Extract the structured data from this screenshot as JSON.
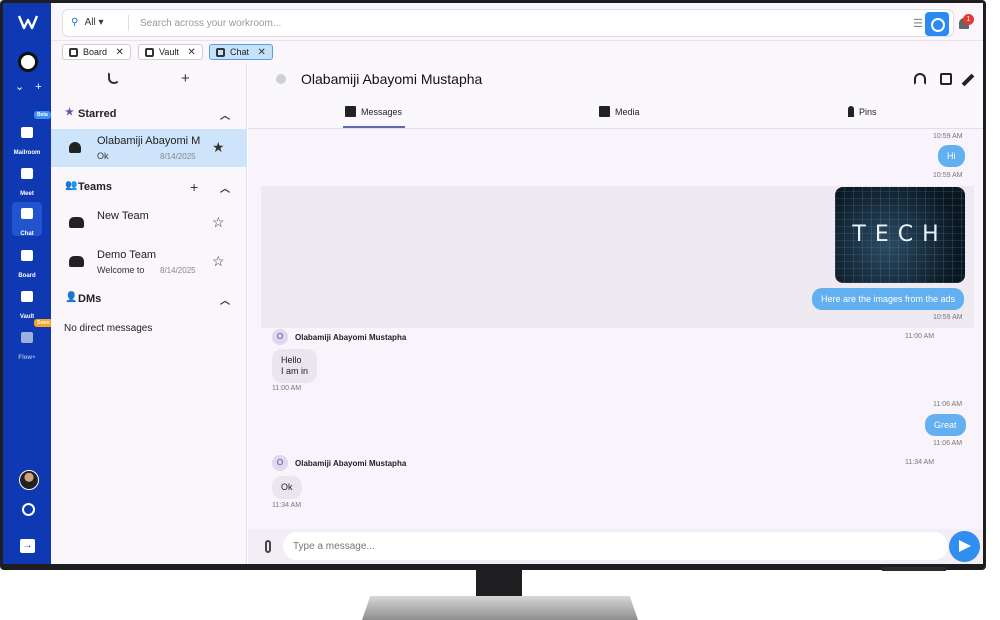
{
  "rail": {
    "items": [
      {
        "label": "Mailroom",
        "icon": "mailroom-icon"
      },
      {
        "label": "Meet",
        "icon": "video-icon"
      },
      {
        "label": "Chat",
        "icon": "chat-icon"
      },
      {
        "label": "Board",
        "icon": "board-icon"
      },
      {
        "label": "Vault",
        "icon": "vault-icon"
      },
      {
        "label": "Flow+",
        "icon": "flow-icon"
      }
    ],
    "badge_beta": "Beta",
    "badge_soon": "Soon",
    "ws_caret": "⌄",
    "ws_add": "+"
  },
  "search": {
    "scope": "All",
    "placeholder": "Search across your workroom..."
  },
  "notifications": {
    "count": "1"
  },
  "app_tabs": [
    {
      "label": "Board"
    },
    {
      "label": "Vault"
    },
    {
      "label": "Chat"
    }
  ],
  "sidebar": {
    "starred": {
      "title": "Starred",
      "items": [
        {
          "name": "Olabamiji Abayomi Mustapha",
          "preview": "Ok",
          "date": "8/14/2025"
        }
      ]
    },
    "teams": {
      "title": "Teams",
      "items": [
        {
          "name": "New Team",
          "preview": "",
          "date": ""
        },
        {
          "name": "Demo Team",
          "preview": "Welcome to Demo Team",
          "date": "8/14/2025"
        }
      ]
    },
    "dms": {
      "title": "DMs",
      "empty": "No direct messages"
    }
  },
  "chat": {
    "title": "Olabamiji Abayomi Mustapha",
    "tabs": [
      "Messages",
      "Media",
      "Pins"
    ],
    "messages": [
      {
        "ts_top": "10:59 AM",
        "text": "Hi",
        "ts_bottom": "10:59 AM"
      },
      {
        "image_text": "TECH",
        "caption": "Here are the images from the ads",
        "ts_bottom": "10:59 AM"
      },
      {
        "sender_initial": "O",
        "sender": "Olabamiji Abayomi Mustapha",
        "sender_ts": "11:00 AM",
        "text_line1": "Hello",
        "text_line2": "I am in",
        "ts": "11:00 AM"
      },
      {
        "ts_top": "11:06 AM",
        "text": "Great",
        "ts_bottom": "11:06 AM"
      },
      {
        "sender_initial": "O",
        "sender": "Olabamiji Abayomi Mustapha",
        "sender_ts": "11:34 AM",
        "text": "Ok",
        "ts": "11:34 AM"
      }
    ],
    "composer_placeholder": "Type a message..."
  },
  "colors": {
    "rail": "#0f39b3",
    "accent": "#2f8ef0",
    "outgoing_bubble": "#62b0f0",
    "selected_row": "#cde4fb",
    "notification": "#e53935"
  }
}
